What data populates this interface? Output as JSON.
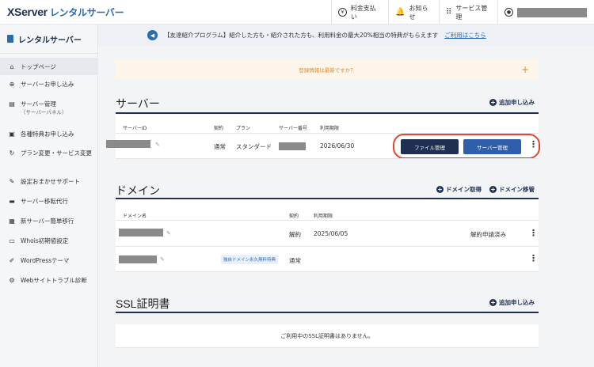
{
  "header": {
    "logo_main": "XServer",
    "logo_sub": "レンタルサーバー",
    "pay_label": "料金支払い",
    "notice_label": "お知らせ",
    "service_label": "サービス管理"
  },
  "sidebar": {
    "title": "レンタルサーバー",
    "items": [
      {
        "label": "トップページ",
        "icon": "home-icon"
      },
      {
        "label": "サーバーお申し込み",
        "icon": "plus-circle-icon"
      },
      {
        "label": "サーバー管理",
        "sub": "（サーバーパネル）",
        "icon": "server-icon"
      },
      {
        "label": "各種特典お申し込み",
        "icon": "gift-icon"
      },
      {
        "label": "プラン変更・サービス変更",
        "icon": "refresh-icon"
      },
      {
        "label": "設定おまかせサポート",
        "icon": "wrench-icon"
      },
      {
        "label": "サーバー移転代行",
        "icon": "truck-icon"
      },
      {
        "label": "新サーバー簡単移行",
        "icon": "migrate-icon"
      },
      {
        "label": "Whois初期値設定",
        "icon": "document-icon"
      },
      {
        "label": "WordPressテーマ",
        "icon": "edit-icon"
      },
      {
        "label": "Webサイトトラブル診断",
        "icon": "diagnose-icon"
      }
    ]
  },
  "notice": {
    "text": "【友達紹介プログラム】紹介した方も・紹介された方も、利用料金の最大20%相当の特典がもらえます",
    "link": "ご利用はこちら"
  },
  "alert": {
    "text": "登録情報は最新ですか？",
    "plus": "+"
  },
  "server": {
    "title": "サーバー",
    "add": "追加申し込み",
    "headers": {
      "id": "サーバーID",
      "contract": "契約",
      "plan": "プラン",
      "number": "サーバー番号",
      "period": "利用期限"
    },
    "row": {
      "contract": "通常",
      "plan": "スタンダード",
      "period": "2026/06/30"
    },
    "btn_file": "ファイル管理",
    "btn_server": "サーバー管理"
  },
  "domain": {
    "title": "ドメイン",
    "get": "ドメイン取得",
    "transfer": "ドメイン移管",
    "headers": {
      "name": "ドメイン名",
      "contract": "契約",
      "period": "利用期限"
    },
    "rows": [
      {
        "contract": "解約",
        "period": "2025/06/05",
        "status": "解約申請済み"
      },
      {
        "tag": "独自ドメイン永久無料特典",
        "contract": "通常"
      }
    ]
  },
  "ssl": {
    "title": "SSL証明書",
    "add": "追加申し込み",
    "empty": "ご利用中のSSL証明書はありません。"
  },
  "colors": {
    "navy": "#1e2f52",
    "blue": "#2f5faa",
    "highlight": "#e0462f",
    "alert": "#e08a2b"
  }
}
